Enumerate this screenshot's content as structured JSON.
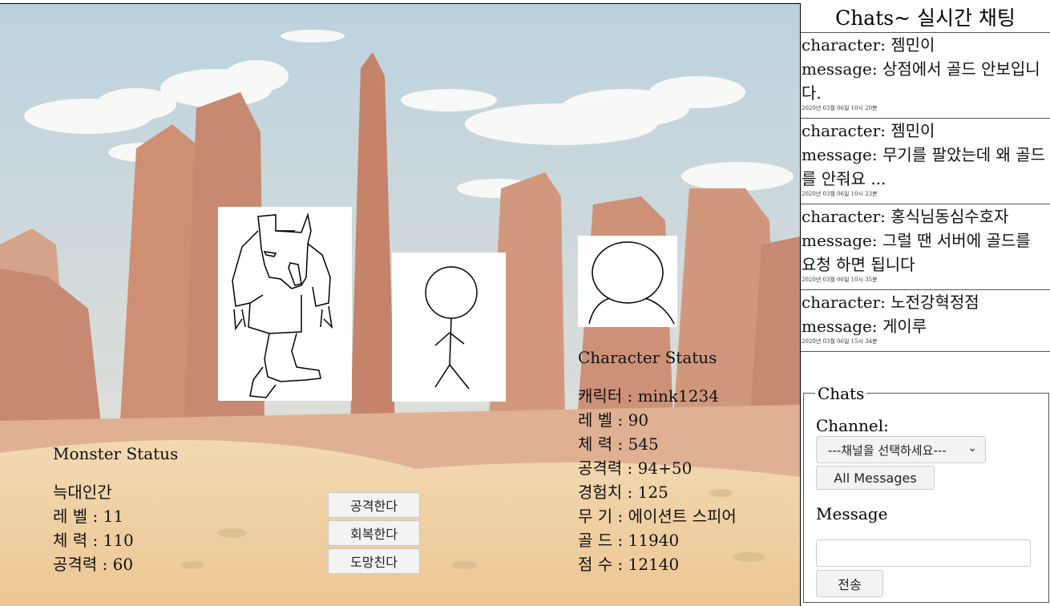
{
  "monster": {
    "title": "Monster Status",
    "name": "늑대인간",
    "level": "레 벨 : 11",
    "hp": "체 력 : 110",
    "attack": "공격력 : 60"
  },
  "actions": {
    "attack": "공격한다",
    "heal": "회복한다",
    "flee": "도망친다"
  },
  "character": {
    "title": "Character Status",
    "name": "캐릭터 : mink1234",
    "level": "레 벨 : 90",
    "hp": "체 력 : 545",
    "attack": "공격력 : 94+50",
    "exp": "경험치 : 125",
    "weapon": "무 기 : 에이션트 스피어",
    "gold": "골 드 : 11940",
    "score": "점 수 : 12140"
  },
  "chat": {
    "title": "Chats~ 실시간 채팅",
    "messages": [
      {
        "character": "character: 젬민이",
        "message": "message: 상점에서 골드 안보입니다.",
        "time": "2020년 03월 06일 10시 20분"
      },
      {
        "character": "character: 젬민이",
        "message": "message: 무기를 팔았는데 왜 골드를 안줘요 ...",
        "time": "2020년 03월 06일 10시 23분"
      },
      {
        "character": "character: 홍식님동심수호자",
        "message": "message: 그럴 땐 서버에 골드를 요청 하면 됩니다",
        "time": "2020년 03월 06일 10시 35분"
      },
      {
        "character": "character: 노전강혁정점",
        "message": "message: 게이루",
        "time": "2020년 03월 06일 15시 34분"
      }
    ],
    "composer": {
      "legend": "Chats",
      "channel_label": "Channel:",
      "channel_selected": "---채널을 선택하세요---",
      "all_messages": "All Messages",
      "message_label": "Message",
      "message_value": "",
      "send": "전송"
    }
  },
  "colors": {
    "sky": "#aac8d8",
    "rock": "#c47a55",
    "sand": "#e8c995"
  }
}
